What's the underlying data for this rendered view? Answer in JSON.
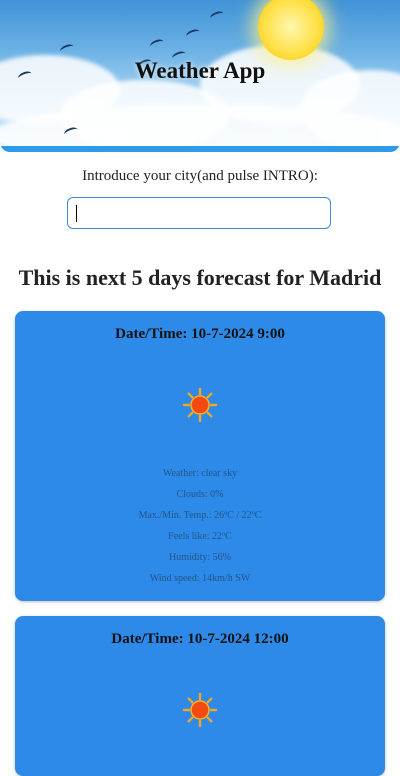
{
  "header": {
    "title": "Weather App"
  },
  "search": {
    "label": "Introduce your city(and pulse INTRO):",
    "value": "",
    "placeholder": ""
  },
  "forecast": {
    "heading": "This is next 5 days forecast for Madrid",
    "cards": [
      {
        "datetime": "Date/Time: 10-7-2024 9:00",
        "icon": "sun-icon",
        "weather": "Weather: clear sky",
        "clouds": "Clouds: 0%",
        "temp": "Max./Min. Temp.: 26ºC / 22ºC",
        "feels_like": "Feels like: 22ºC",
        "humidity": "Humidity: 56%",
        "wind": "Wind speed: 14km/h SW"
      },
      {
        "datetime": "Date/Time: 10-7-2024 12:00",
        "icon": "sun-icon"
      }
    ]
  },
  "colors": {
    "card_bg": "#2d8ae8",
    "input_border": "#3f8ad8",
    "detail_text": "#23558a"
  }
}
